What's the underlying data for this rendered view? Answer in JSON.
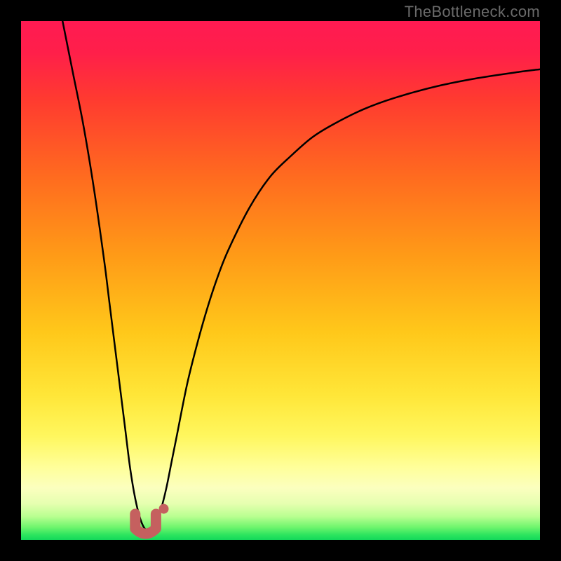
{
  "attribution": "TheBottleneck.com",
  "colors": {
    "frame": "#000000",
    "gradient_stops": [
      {
        "offset": 0.0,
        "color": "#ff1a52"
      },
      {
        "offset": 0.06,
        "color": "#ff1f4a"
      },
      {
        "offset": 0.15,
        "color": "#ff3a30"
      },
      {
        "offset": 0.3,
        "color": "#ff6b1f"
      },
      {
        "offset": 0.45,
        "color": "#ff9a17"
      },
      {
        "offset": 0.6,
        "color": "#ffc81a"
      },
      {
        "offset": 0.72,
        "color": "#ffe638"
      },
      {
        "offset": 0.8,
        "color": "#fff75e"
      },
      {
        "offset": 0.86,
        "color": "#ffff9a"
      },
      {
        "offset": 0.9,
        "color": "#fbffbf"
      },
      {
        "offset": 0.93,
        "color": "#e6ffb0"
      },
      {
        "offset": 0.955,
        "color": "#b8ff90"
      },
      {
        "offset": 0.975,
        "color": "#70f56e"
      },
      {
        "offset": 0.99,
        "color": "#2de55f"
      },
      {
        "offset": 1.0,
        "color": "#13d85a"
      }
    ],
    "curve": "#000000",
    "marker_fill": "#c5605f",
    "marker_stroke": "#c5605f"
  },
  "chart_data": {
    "type": "line",
    "title": "",
    "xlabel": "",
    "ylabel": "",
    "xlim": [
      0,
      100
    ],
    "ylim": [
      0,
      100
    ],
    "series": [
      {
        "name": "bottleneck-curve",
        "x": [
          8,
          10,
          12,
          14,
          16,
          17,
          18,
          19,
          20,
          21,
          22,
          23,
          24,
          25,
          26,
          27,
          28,
          29,
          30,
          32,
          34,
          36,
          38,
          40,
          44,
          48,
          52,
          56,
          60,
          66,
          72,
          80,
          88,
          96,
          100
        ],
        "y": [
          100,
          90,
          80,
          68,
          54,
          46,
          38,
          30,
          22,
          14,
          8,
          4,
          2,
          2,
          3,
          6,
          10,
          15,
          20,
          30,
          38,
          45,
          51,
          56,
          64,
          70,
          74,
          77.5,
          80,
          83,
          85.2,
          87.4,
          89,
          90.2,
          90.7
        ]
      }
    ],
    "optimum_zone": {
      "x_range": [
        22,
        26
      ],
      "y_range": [
        1,
        5
      ]
    },
    "extra_marker": {
      "x": 27.5,
      "y": 6
    }
  }
}
